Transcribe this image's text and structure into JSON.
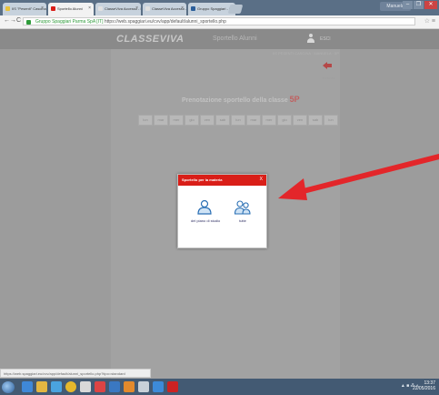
{
  "browser": {
    "tabs": [
      {
        "label": "IIS \"Pesenti\" Cascina",
        "active": false,
        "favicon_color": "#e8c23a"
      },
      {
        "label": "Sportello Alunni",
        "active": true,
        "favicon_color": "#d91e18"
      },
      {
        "label": "ClasseViva Accesso - Prenota...",
        "active": false,
        "favicon_color": "#e0e0e0"
      },
      {
        "label": "ClasseViva Accesso - Prenota...",
        "active": false,
        "favicon_color": "#e0e0e0"
      },
      {
        "label": "Gruppo Spaggiari - Servizi",
        "active": false,
        "favicon_color": "#2b5e9a"
      }
    ],
    "tab_close": "×",
    "user_badge": "Manuela",
    "win_buttons": [
      "–",
      "❐",
      "✕"
    ],
    "back": "←",
    "forward": "→",
    "reload": "C",
    "url_secure": "Gruppo Spaggiari Parma SpA [IT]",
    "url": "https://web.spaggiari.eu/cvv/app/default/alunni_sportello.php",
    "addr_right": "☆ ≡"
  },
  "header": {
    "logo": "CLASSEVIVA",
    "section": "Sportello Alunni",
    "esci": "ESCI",
    "sub_info": "IIS PESENTI CASCINA · MANUELA · 5P"
  },
  "page": {
    "back_label": "Indietro",
    "title_prefix": "Prenotazione sportello della classe",
    "class_name": "5P",
    "dates": [
      "lun",
      "mar",
      "mer",
      "gio",
      "ven",
      "sab",
      "lun",
      "mar",
      "mer",
      "gio",
      "ven",
      "sab",
      "lun"
    ]
  },
  "modal": {
    "title": "Sportello per la materia",
    "close": "X",
    "options": [
      {
        "label": "del piano di studio"
      },
      {
        "label": "tutte"
      }
    ]
  },
  "status_bar": {
    "text": "https://web.spaggiari.eu/cvv/app/default/alunni_sportello.php?tipo=standard"
  },
  "taskbar": {
    "tray": "▲ ■ ⁂ ◐",
    "time": "13:37",
    "date": "22/05/2016"
  },
  "colors": {
    "accent": "#d91e18",
    "annotation_arrow": "#e3262a"
  }
}
